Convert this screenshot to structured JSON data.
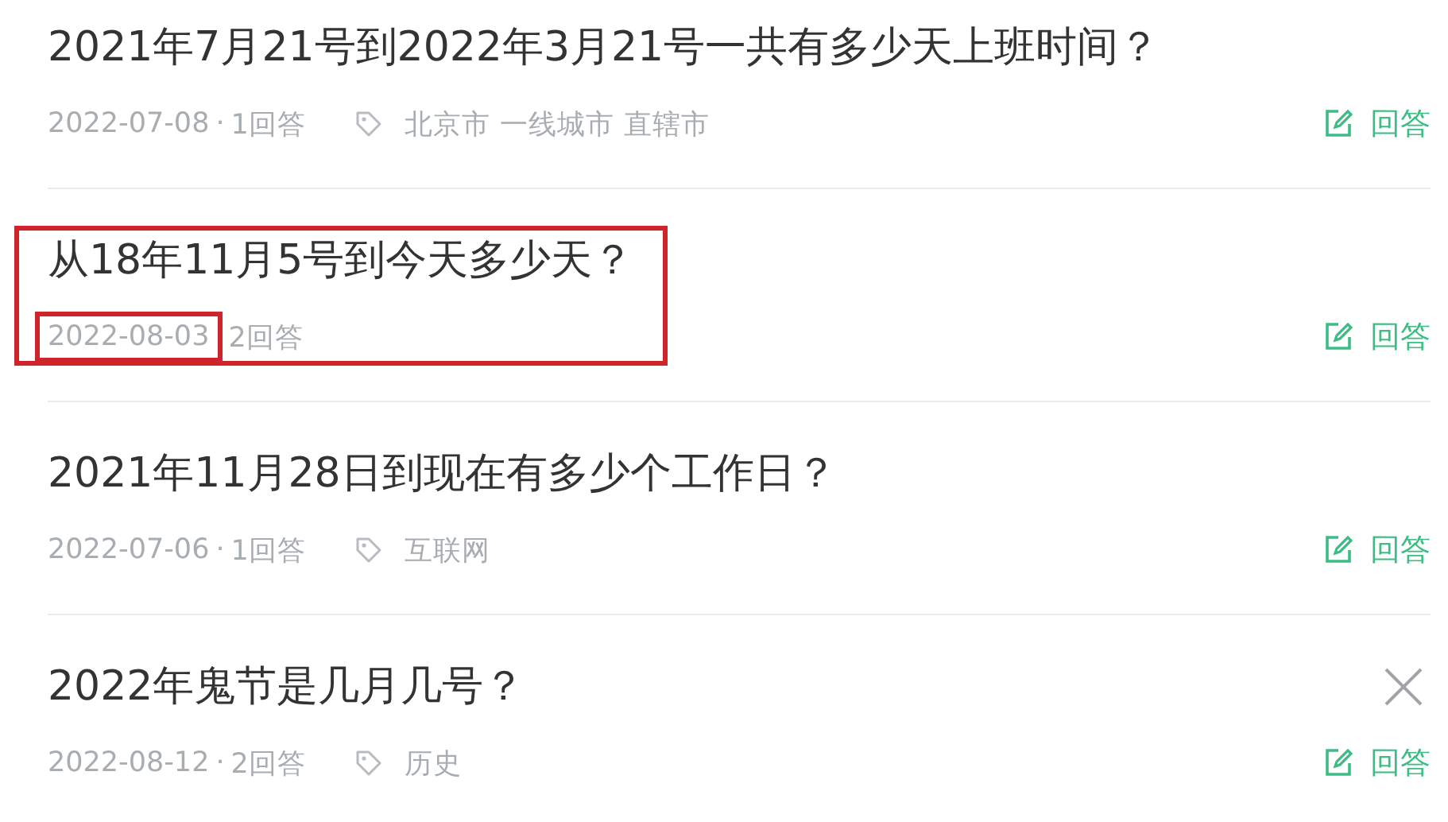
{
  "questions": [
    {
      "title": "2021年7月21号到2022年3月21号一共有多少天上班时间？",
      "date": "2022-07-08",
      "separator": "·",
      "answers": "1回答",
      "tags": [
        "北京市",
        "一线城市",
        "直辖市"
      ],
      "highlighted": false,
      "date_highlighted": false,
      "closable": false,
      "answer_button": "回答"
    },
    {
      "title": "从18年11月5号到今天多少天？",
      "date": "2022-08-03",
      "answers": "2回答",
      "highlighted": true,
      "date_highlighted": true,
      "closable": false,
      "answer_button": "回答"
    },
    {
      "title": "2021年11月28日到现在有多少个工作日？",
      "date": "2022-07-06",
      "separator": "·",
      "answers": "1回答",
      "tags": [
        "互联网"
      ],
      "highlighted": false,
      "date_highlighted": false,
      "closable": false,
      "answer_button": "回答"
    },
    {
      "title": "2022年鬼节是几月几号？",
      "date": "2022-08-12",
      "separator": "·",
      "answers": "2回答",
      "tags": [
        "历史"
      ],
      "highlighted": false,
      "date_highlighted": false,
      "closable": true,
      "answer_button": "回答"
    }
  ]
}
